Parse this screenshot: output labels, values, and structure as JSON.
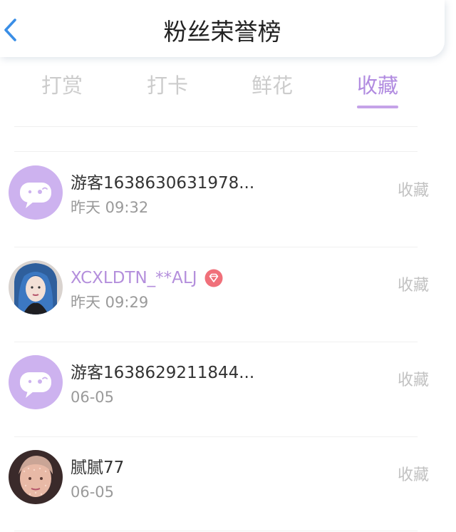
{
  "header": {
    "title": "粉丝荣誉榜",
    "back_icon": "chevron-left-icon",
    "accent_color": "#3a8ee6"
  },
  "tabs": [
    {
      "label": "打赏",
      "active": false
    },
    {
      "label": "打卡",
      "active": false
    },
    {
      "label": "鲜花",
      "active": false
    },
    {
      "label": "收藏",
      "active": true
    }
  ],
  "tab_active_color": "#b18be0",
  "fans": [
    {
      "name": "游客1638630631978...",
      "time": "昨天 09:32",
      "action": "收藏",
      "avatar": "default-chat-avatar",
      "vip": false
    },
    {
      "name": "XCXLDTN_**ALJ",
      "time": "昨天 09:29",
      "action": "收藏",
      "avatar": "photo-avatar",
      "vip": true
    },
    {
      "name": "游客1638629211844...",
      "time": "06-05",
      "action": "收藏",
      "avatar": "default-chat-avatar",
      "vip": false
    },
    {
      "name": "腻腻77",
      "time": "06-05",
      "action": "收藏",
      "avatar": "photo-avatar",
      "vip": false
    }
  ]
}
